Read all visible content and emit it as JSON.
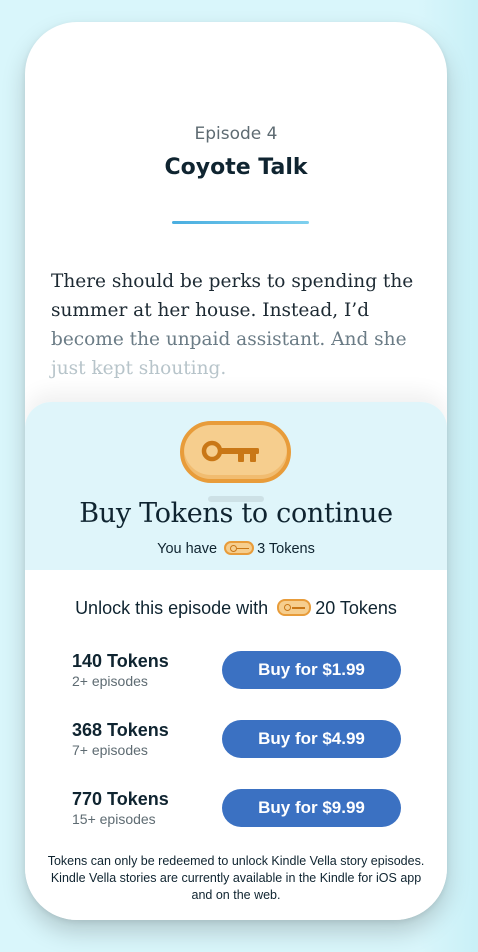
{
  "episode": {
    "label": "Episode 4",
    "title": "Coyote Talk",
    "excerpt_lines": [
      "There should be perks to spending the",
      "summer at her house. Instead, I’d",
      "become the unpaid assistant. And she",
      "just kept shouting."
    ]
  },
  "paywall": {
    "icon": "key-icon",
    "title": "Buy Tokens to continue",
    "balance_prefix": "You have",
    "balance_value": "3 Tokens",
    "unlock_prefix": "Unlock this episode with",
    "unlock_cost": "20 Tokens",
    "offers": [
      {
        "tokens": "140 Tokens",
        "episodes": "2+ episodes",
        "button": "Buy for $1.99"
      },
      {
        "tokens": "368 Tokens",
        "episodes": "7+ episodes",
        "button": "Buy for $4.99"
      },
      {
        "tokens": "770 Tokens",
        "episodes": "15+ episodes",
        "button": "Buy for $9.99"
      }
    ],
    "footnote": "Tokens can only be redeemed to unlock Kindle Vella story episodes. Kindle Vella stories are currently available in the Kindle for iOS app and on the web."
  },
  "colors": {
    "background": "#d9f6fb",
    "sheet_header": "#dff5fa",
    "accent_button": "#3b71c2",
    "key_fill": "#f6ce8e",
    "key_stroke": "#e89c3a"
  }
}
